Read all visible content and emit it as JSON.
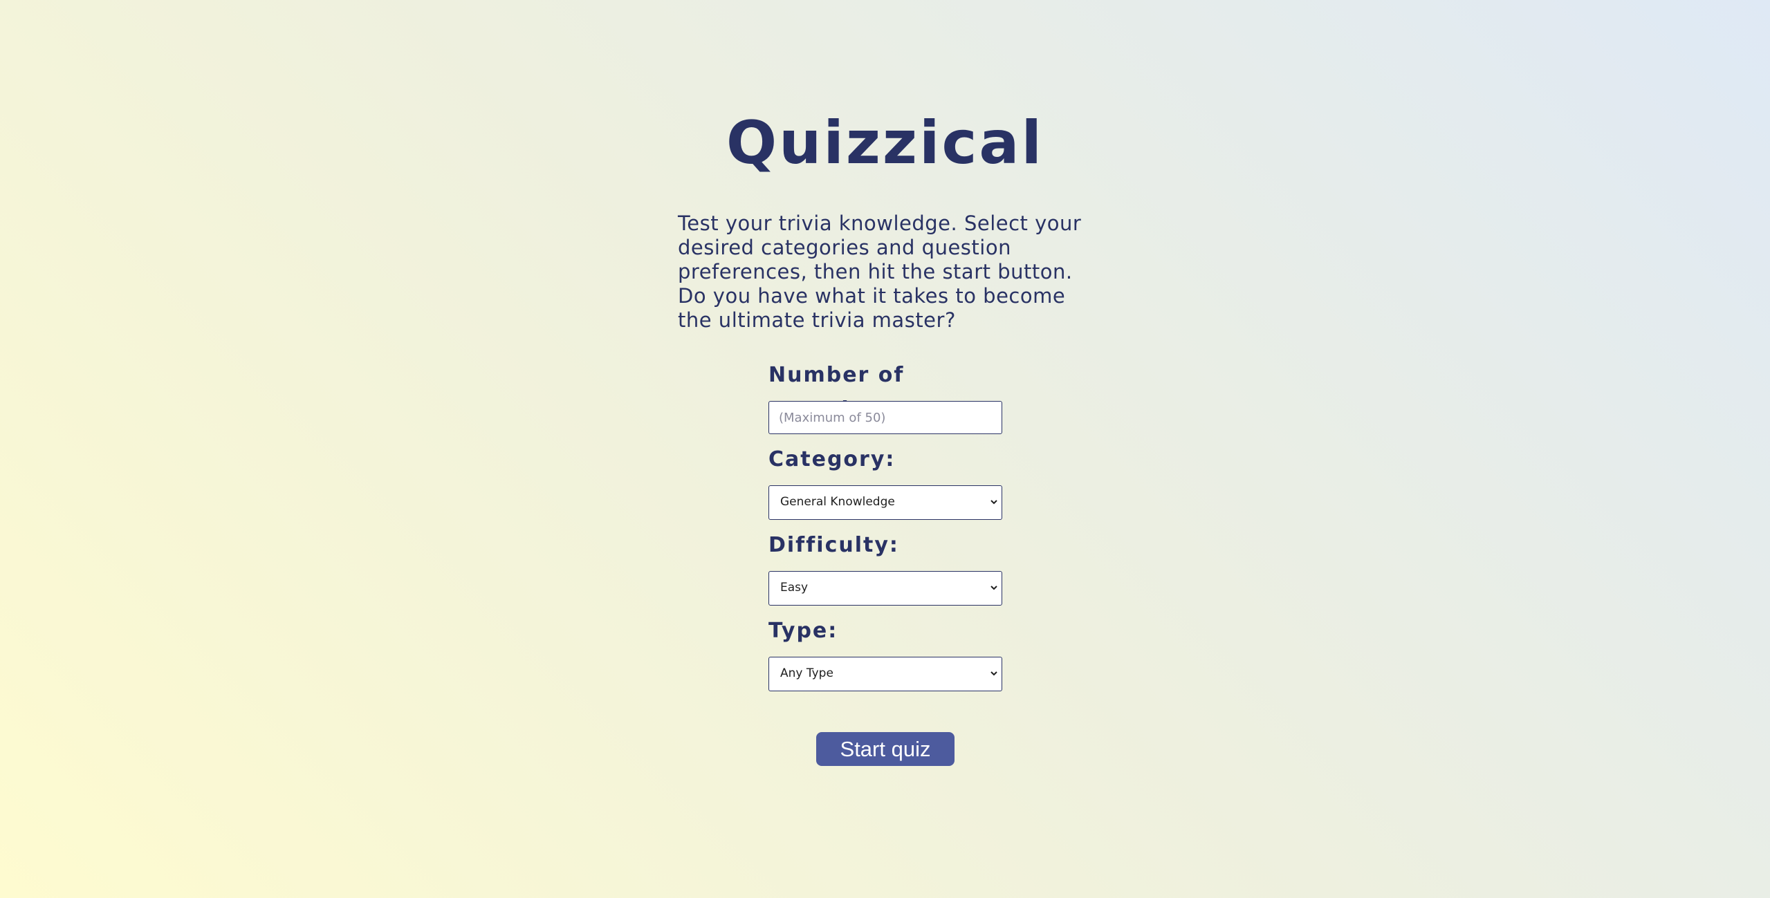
{
  "app": {
    "title": "Quizzical",
    "description": "Test your trivia knowledge. Select your desired categories and question preferences, then hit the start button. Do you have what it takes to become the ultimate trivia master?"
  },
  "form": {
    "number_of_questions": {
      "label": "Number of questions:",
      "value": "",
      "placeholder": "(Maximum of 50)"
    },
    "category": {
      "label": "Category:",
      "selected": "General Knowledge"
    },
    "difficulty": {
      "label": "Difficulty:",
      "selected": "Easy"
    },
    "type": {
      "label": "Type:",
      "selected": "Any Type"
    },
    "start_button": "Start quiz"
  },
  "colors": {
    "primary_text": "#293264",
    "button_background": "#4d5b9e",
    "button_text": "#ffffff",
    "input_background": "#ffffff"
  },
  "icons": {
    "select_arrow": "chevron-down-icon"
  }
}
